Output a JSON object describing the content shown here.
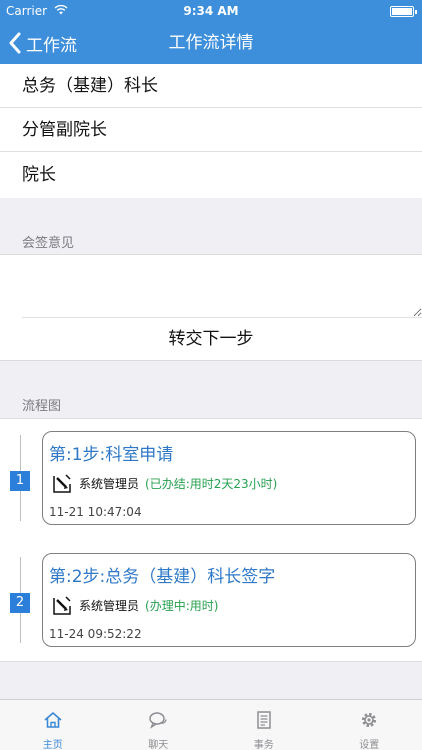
{
  "status_bar": {
    "carrier": "Carrier",
    "time": "9:34 AM"
  },
  "nav": {
    "back_label": "工作流",
    "title": "工作流详情"
  },
  "approvers": [
    "总务（基建）科长",
    "分管副院长",
    "院长"
  ],
  "countersign": {
    "label": "会签意见",
    "value": "",
    "placeholder": "",
    "submit_label": "转交下一步"
  },
  "flow": {
    "label": "流程图",
    "steps": [
      {
        "number": "1",
        "title": "第:1步:科室申请",
        "user": "系统管理员",
        "state": "(已办结:用时2天23小时)",
        "time": "11-21 10:47:04"
      },
      {
        "number": "2",
        "title": "第:2步:总务（基建）科长签字",
        "user": "系统管理员",
        "state": "(办理中:用时)",
        "time": "11-24 09:52:22"
      }
    ]
  },
  "tabbar": {
    "active": "home",
    "items": [
      {
        "label": "主页",
        "icon": "home-icon"
      },
      {
        "label": "聊天",
        "icon": "chat-icon"
      },
      {
        "label": "事务",
        "icon": "document-icon"
      },
      {
        "label": "设置",
        "icon": "gear-icon"
      }
    ]
  },
  "colors": {
    "nav": "#3d8fdc",
    "accent": "#2f78c7",
    "done": "#27a050",
    "step_badge": "#2b7fd8"
  }
}
